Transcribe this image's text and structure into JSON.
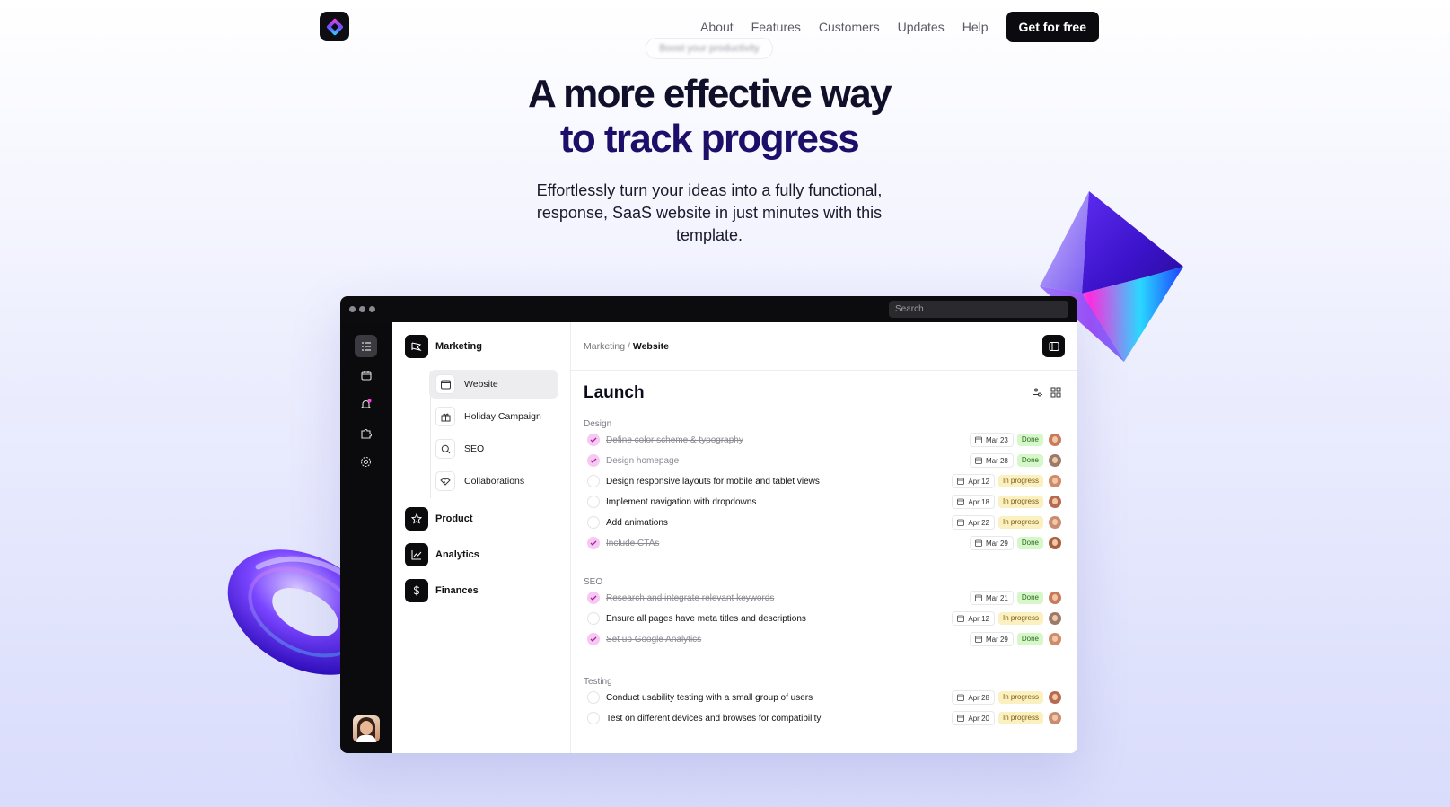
{
  "nav": {
    "links": [
      "About",
      "Features",
      "Customers",
      "Updates",
      "Help"
    ],
    "cta": "Get for free"
  },
  "pill": "Boost your productivity",
  "hero": {
    "title_line1": "A more effective way",
    "title_line2": "to track progress",
    "subtitle": "Effortlessly turn your ideas into a fully functional, response, SaaS website in just minutes with this template."
  },
  "app": {
    "search_placeholder": "Search",
    "sidebar": {
      "marketing": "Marketing",
      "sub_items": [
        "Website",
        "Holiday Campaign",
        "SEO",
        "Collaborations"
      ],
      "groups": [
        "Product",
        "Analytics",
        "Finances"
      ]
    },
    "breadcrumb": {
      "parent": "Marketing",
      "separator": " / ",
      "current": "Website"
    },
    "heading": "Launch",
    "sections": [
      {
        "name": "Design",
        "tasks": [
          {
            "title": "Define color scheme & typography",
            "done": true,
            "date": "Mar 23",
            "status": "Done"
          },
          {
            "title": "Design homepage",
            "done": true,
            "date": "Mar 28",
            "status": "Done"
          },
          {
            "title": "Design responsive layouts for mobile and tablet views",
            "done": false,
            "date": "Apr 12",
            "status": "In progress"
          },
          {
            "title": "Implement navigation with dropdowns",
            "done": false,
            "date": "Apr 18",
            "status": "In progress"
          },
          {
            "title": "Add animations",
            "done": false,
            "date": "Apr 22",
            "status": "In progress"
          },
          {
            "title": "Include CTAs",
            "done": true,
            "date": "Mar 29",
            "status": "Done"
          }
        ]
      },
      {
        "name": "SEO",
        "tasks": [
          {
            "title": "Research and integrate relevant keywords",
            "done": true,
            "date": "Mar 21",
            "status": "Done"
          },
          {
            "title": "Ensure all pages have meta titles and descriptions",
            "done": false,
            "date": "Apr 12",
            "status": "In progress"
          },
          {
            "title": "Set up Google Analytics",
            "done": true,
            "date": "Mar 29",
            "status": "Done"
          }
        ]
      },
      {
        "name": "Testing",
        "tasks": [
          {
            "title": "Conduct usability testing with a small group of users",
            "done": false,
            "date": "Apr 28",
            "status": "In progress"
          },
          {
            "title": "Test on different devices and browses for compatibility",
            "done": false,
            "date": "Apr 20",
            "status": "In progress"
          }
        ]
      }
    ]
  },
  "colors": {
    "accent_dark": "#1d0e6a",
    "done_badge": "#d6f7c9",
    "progress_badge": "#fbf0bf",
    "check_done": "#f6c9f2"
  }
}
